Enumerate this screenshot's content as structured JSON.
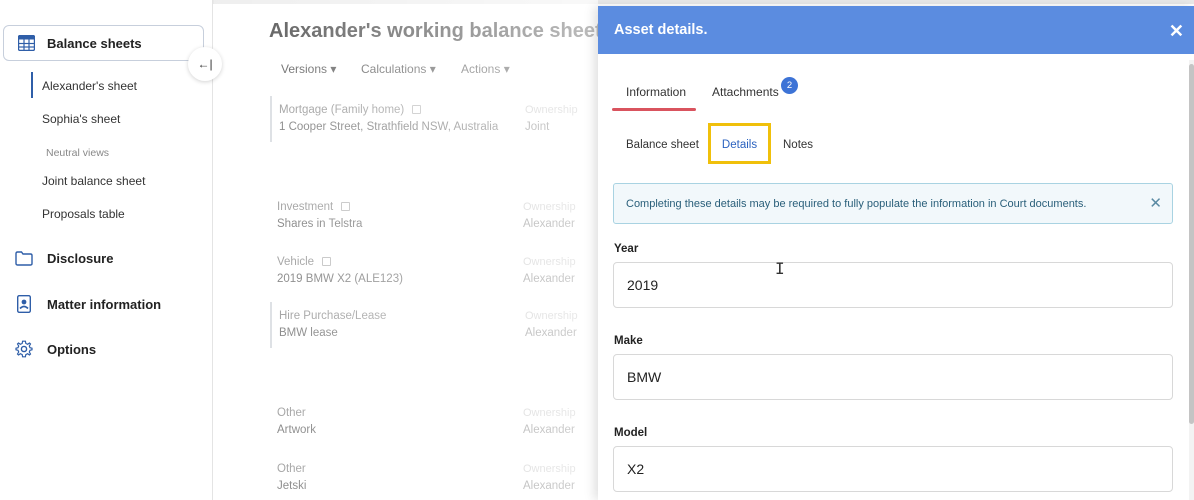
{
  "sidebar": {
    "balance_sheets": "Balance sheets",
    "items": [
      "Alexander's sheet",
      "Sophia's sheet"
    ],
    "neutral_caption": "Neutral views",
    "neutral_items": [
      "Joint balance sheet",
      "Proposals table"
    ],
    "disclosure": "Disclosure",
    "matter_information": "Matter information",
    "options": "Options",
    "collapse_glyph": "←|"
  },
  "main": {
    "title": "Alexander's working balance sheet",
    "menus": [
      "Versions",
      "Calculations",
      "Actions"
    ],
    "ownership_label": "Ownership",
    "rows": [
      {
        "category": "Mortgage (Family home)",
        "description": "1 Cooper Street, Strathfield NSW, Australia",
        "owner": "Joint"
      },
      {
        "category": "Investment",
        "description": "Shares in Telstra",
        "owner": "Alexander"
      },
      {
        "category": "Vehicle",
        "description": "2019 BMW X2 (ALE123)",
        "owner": "Alexander"
      },
      {
        "category": "Hire Purchase/Lease",
        "description": "BMW lease",
        "owner": "Alexander"
      },
      {
        "category": "Other",
        "description": "Artwork",
        "owner": "Alexander"
      },
      {
        "category": "Other",
        "description": "Jetski",
        "owner": "Alexander"
      }
    ]
  },
  "panel": {
    "title": "Asset details.",
    "tabs": {
      "information": "Information",
      "attachments": "Attachments",
      "attachments_count": "2"
    },
    "subtabs": {
      "balance_sheet": "Balance sheet",
      "details": "Details",
      "notes": "Notes"
    },
    "alert": "Completing these details may be required to fully populate the information in Court documents.",
    "fields": {
      "year": {
        "label": "Year",
        "value": "2019"
      },
      "make": {
        "label": "Make",
        "value": "BMW"
      },
      "model": {
        "label": "Model",
        "value": "X2"
      }
    }
  },
  "colors": {
    "header": "#5b8ce0",
    "highlight": "#f0c00b",
    "tab_underline": "#d9535e",
    "badge": "#3d73d6"
  }
}
